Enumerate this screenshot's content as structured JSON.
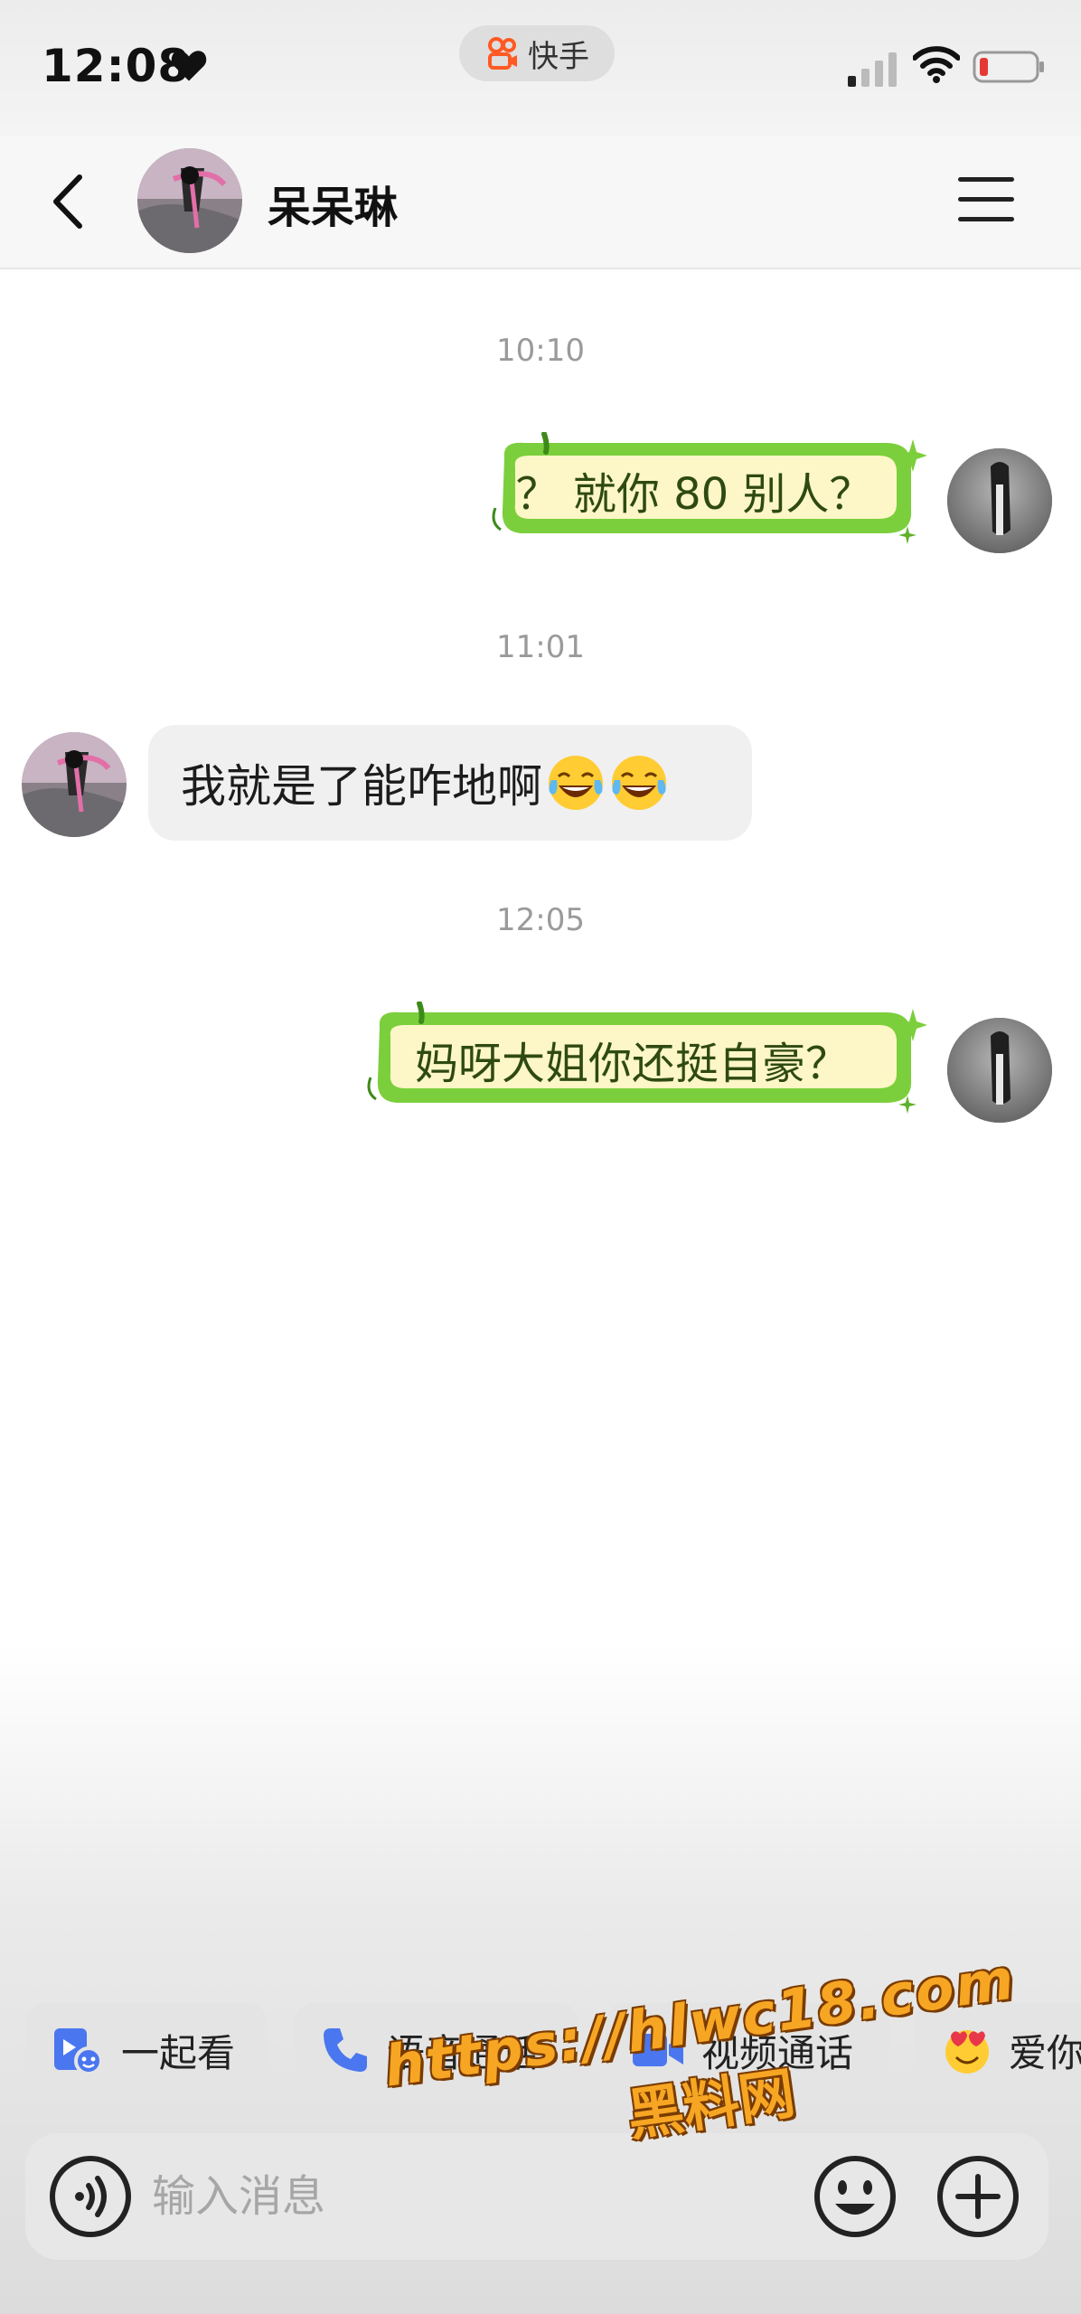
{
  "status_bar": {
    "time": "12:08",
    "app_name": "快手",
    "icons": [
      "heart-icon",
      "kuaishou-icon",
      "signal-icon",
      "wifi-icon",
      "battery-low-icon"
    ]
  },
  "header": {
    "contact_name": "呆呆琳",
    "icons": [
      "back-icon",
      "menu-icon"
    ]
  },
  "messages": [
    {
      "type": "timestamp",
      "text": "10:10"
    },
    {
      "type": "outgoing",
      "text": "？ 就你 80 别人？",
      "style": "green-bubble"
    },
    {
      "type": "timestamp",
      "text": "11:01"
    },
    {
      "type": "incoming",
      "text": "我就是了能咋地啊",
      "emoji": [
        "tears-of-joy-emoji",
        "tears-of-joy-emoji"
      ]
    },
    {
      "type": "timestamp",
      "text": "12:05"
    },
    {
      "type": "outgoing",
      "text": "妈呀大姐你还挺自豪？",
      "style": "green-bubble"
    }
  ],
  "quick_actions": [
    {
      "label": "一起看",
      "icon": "watch-together-icon"
    },
    {
      "label": "语音通话",
      "icon": "phone-icon"
    },
    {
      "label": "视频通话",
      "icon": "video-camera-icon"
    },
    {
      "label": "爱你",
      "icon": "heart-face-emoji"
    }
  ],
  "input": {
    "placeholder": "输入消息"
  },
  "watermark": {
    "line1": "https://hlwc18.com",
    "line2": "黑料网"
  },
  "colors": {
    "bubble_green": "#7ccf3c",
    "bubble_fill": "#fdf6c6",
    "incoming_bubble": "#f0f0f0",
    "kuaishou_orange": "#ff5a23",
    "accent_blue": "#4a77f0",
    "battery_red": "#e53935"
  }
}
